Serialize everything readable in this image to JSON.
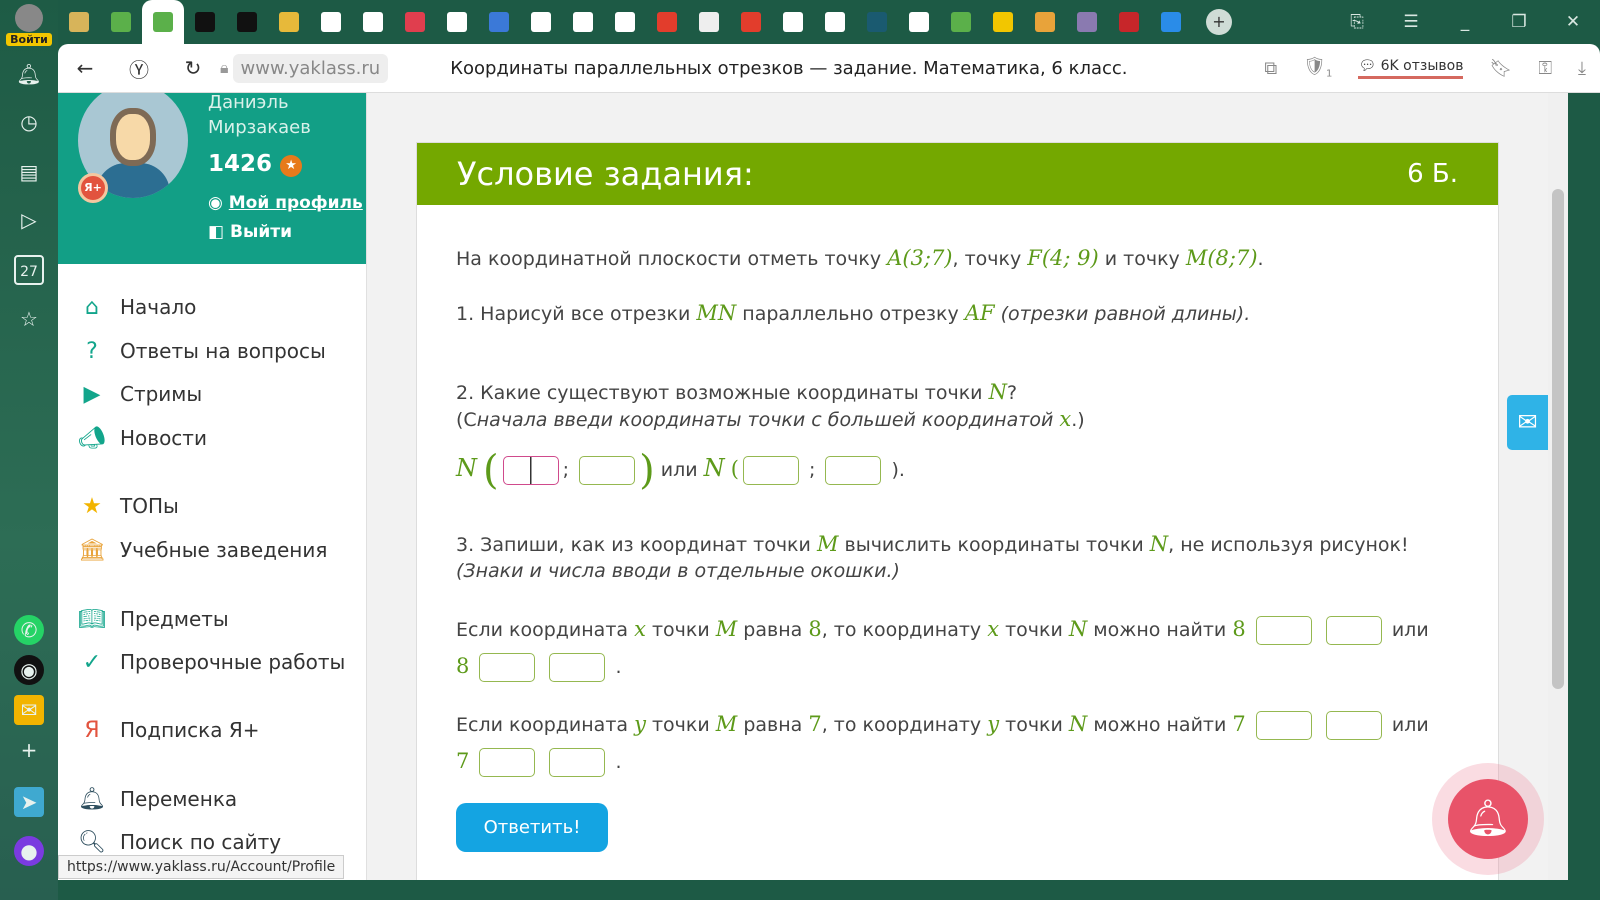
{
  "browser": {
    "login_label": "Войти",
    "tab_icons": [
      "pointer-icon",
      "book-icon",
      "book-icon",
      "z-icon",
      "z-icon",
      "classroom-icon",
      "play-icon",
      "gmail-icon",
      "heart-icon",
      "gmail-icon",
      "contacts-icon",
      "play-icon",
      "doc-icon",
      "doc-icon",
      "yandex-icon",
      "image-icon",
      "yandex-icon",
      "doc-icon",
      "doc-icon",
      "blank-icon",
      "doc-icon",
      "book-icon",
      "paragraph-icon",
      "tiles-icon",
      "circle-icon",
      "adobe-icon",
      "chat-icon"
    ],
    "tab_colors": [
      "#d7b45a",
      "#5bb04a",
      "#5bb04a",
      "#111111",
      "#111111",
      "#e7b93a",
      "#ffffff",
      "#ffffff",
      "#e03e4e",
      "#ffffff",
      "#3b79d8",
      "#ffffff",
      "#ffffff",
      "#ffffff",
      "#e23d2c",
      "#eeeeee",
      "#e23d2c",
      "#ffffff",
      "#ffffff",
      "#1a5a70",
      "#ffffff",
      "#5bb04a",
      "#f2c600",
      "#e8a33a",
      "#8a7ab0",
      "#c7262a",
      "#2a8ce8"
    ],
    "url": "www.yaklass.ru",
    "page_title": "Координаты параллельных отрезков — задание. Математика, 6 класс.",
    "reviews": "6K отзывов",
    "shield_badge": "1",
    "status_url": "https://www.yaklass.ru/Account/Profile",
    "calendar_day": "27"
  },
  "profile": {
    "first_name": "Даниэль",
    "last_name": "Мирзакаев",
    "score": "1426",
    "badge": "Я+",
    "my_profile": "Мой профиль",
    "logout": "Выйти"
  },
  "menu": [
    {
      "label": "Начало",
      "icon": "home-icon"
    },
    {
      "label": "Ответы на вопросы",
      "icon": "question-icon"
    },
    {
      "label": "Стримы",
      "icon": "play-icon"
    },
    {
      "label": "Новости",
      "icon": "megaphone-icon"
    },
    {
      "label": "ТОПы",
      "icon": "star-icon"
    },
    {
      "label": "Учебные заведения",
      "icon": "institution-icon"
    },
    {
      "label": "Предметы",
      "icon": "book-icon"
    },
    {
      "label": "Проверочные работы",
      "icon": "check-icon"
    },
    {
      "label": "Подписка Я+",
      "icon": "yplus-icon"
    },
    {
      "label": "Переменка",
      "icon": "bell-icon"
    },
    {
      "label": "Поиск по сайту",
      "icon": "search-icon"
    }
  ],
  "task": {
    "header": "Условие задания:",
    "points": "6 Б.",
    "intro": {
      "t1": "На координатной плоскости отметь точку ",
      "A": "A(3;7)",
      "t2": ", точку ",
      "F": "F(4; 9)",
      "t3": " и точку ",
      "M": "M(8;7)",
      "t4": "."
    },
    "q1": {
      "t1": "1. Нарисуй все отрезки ",
      "MN": "MN",
      "t2": " параллельно отрезку ",
      "AF": "AF",
      "t3": " (отрезки равной длины)."
    },
    "q2": {
      "t1": "2. Какие существуют возможные координаты точки ",
      "N": "N",
      "t2": "?",
      "t3": "(С",
      "t4": "начала введи координаты точки с большей координатой ",
      "x": "x",
      "t5": ".)"
    },
    "q2_answer": {
      "N": "N",
      "sep": ";",
      "or": "или",
      "end": ")."
    },
    "q3": {
      "t1": "3. Запиши, как из координат точки ",
      "M": "M",
      "t2": " вычислить координаты точки ",
      "N": "N",
      "t3": ", не используя рисунок! ",
      "t4": "(Знаки и числа вводи в отдельные окошки.)"
    },
    "rowx": {
      "t1": "Если координата ",
      "v": "x",
      "t2": " точки ",
      "M": "M",
      "t3": " равна ",
      "val": "8",
      "t4": ", то координату ",
      "t5": " точки ",
      "N": "N",
      "t6": " можно найти ",
      "or": "или",
      "end": "."
    },
    "rowy": {
      "t1": "Если координата ",
      "v": "y",
      "t2": " точки ",
      "M": "M",
      "t3": " равна ",
      "val": "7",
      "t4": ", то координату ",
      "t5": " точки ",
      "N": "N",
      "t6": " можно найти ",
      "or": "или",
      "end": "."
    },
    "submit": "Ответить!"
  },
  "colors": {
    "header_green": "#74a800",
    "profile_teal": "#129f86",
    "button_blue": "#14a4e2",
    "math_green": "#5d9a1a"
  }
}
